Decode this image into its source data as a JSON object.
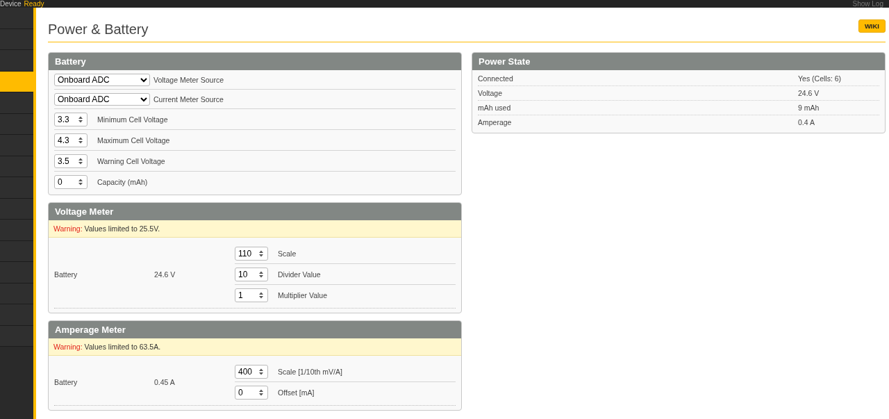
{
  "top_bar": {
    "device_label": "Device",
    "device_status": "Ready",
    "show_log": "Show Log"
  },
  "sidebar": {
    "items": [
      {
        "selected": false
      },
      {
        "selected": false
      },
      {
        "selected": false
      },
      {
        "selected": true
      },
      {
        "selected": false
      },
      {
        "selected": false
      },
      {
        "selected": false
      },
      {
        "selected": false
      },
      {
        "selected": false
      },
      {
        "selected": false
      },
      {
        "selected": false
      },
      {
        "selected": false
      },
      {
        "selected": false
      },
      {
        "selected": false
      },
      {
        "selected": false
      },
      {
        "selected": false
      }
    ]
  },
  "page": {
    "title": "Power & Battery",
    "wiki_button": "WIKI"
  },
  "battery": {
    "title": "Battery",
    "rows": [
      {
        "kind": "select",
        "value": "Onboard ADC",
        "label": "Voltage Meter Source"
      },
      {
        "kind": "select",
        "value": "Onboard ADC",
        "label": "Current Meter Source"
      },
      {
        "kind": "number",
        "value": "3.3",
        "label": "Minimum Cell Voltage"
      },
      {
        "kind": "number",
        "value": "4.3",
        "label": "Maximum Cell Voltage"
      },
      {
        "kind": "number",
        "value": "3.5",
        "label": "Warning Cell Voltage"
      },
      {
        "kind": "number",
        "value": "0",
        "label": "Capacity (mAh)"
      }
    ]
  },
  "meters": [
    {
      "title": "Voltage Meter",
      "warning": "**Warning:** Values limited to 25.5V.",
      "source": "Battery",
      "reading": "24.6 V",
      "fields": [
        {
          "value": "110",
          "label": "Scale"
        },
        {
          "value": "10",
          "label": "Divider Value"
        },
        {
          "value": "1",
          "label": "Multiplier Value"
        }
      ]
    },
    {
      "title": "Amperage Meter",
      "warning": "**Warning:** Values limited to 63.5A.",
      "source": "Battery",
      "reading": "0.45 A",
      "fields": [
        {
          "value": "400",
          "label": "Scale [1/10th mV/A]"
        },
        {
          "value": "0",
          "label": "Offset [mA]"
        }
      ]
    }
  ],
  "power_state": {
    "title": "Power State",
    "rows": [
      {
        "label": "Connected",
        "value": "Yes (Cells: 6)"
      },
      {
        "label": "Voltage",
        "value": "24.6 V"
      },
      {
        "label": "mAh used",
        "value": "9 mAh"
      },
      {
        "label": "Amperage",
        "value": "0.4 A"
      }
    ]
  }
}
